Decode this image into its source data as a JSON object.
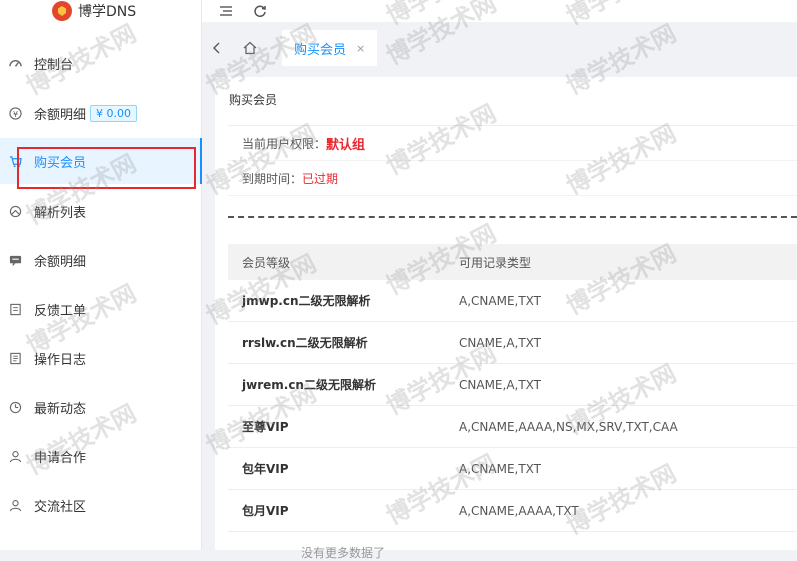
{
  "brand": {
    "name": "博学DNS"
  },
  "sidebar": {
    "items": [
      {
        "label": "控制台",
        "icon": "dashboard-icon"
      },
      {
        "label": "余额明细",
        "icon": "yen-icon",
        "badge": "¥ 0.00"
      },
      {
        "label": "购买会员",
        "icon": "cart-icon"
      },
      {
        "label": "解析列表",
        "icon": "dns-icon"
      },
      {
        "label": "余额明细",
        "icon": "message-icon"
      },
      {
        "label": "反馈工单",
        "icon": "ticket-icon"
      },
      {
        "label": "操作日志",
        "icon": "log-icon"
      },
      {
        "label": "最新动态",
        "icon": "news-icon"
      },
      {
        "label": "申请合作",
        "icon": "user-icon"
      },
      {
        "label": "交流社区",
        "icon": "community-icon"
      }
    ]
  },
  "tabs": {
    "active_label": "购买会员",
    "close_glyph": "×"
  },
  "panel": {
    "title": "购买会员",
    "permission_label": "当前用户权限：",
    "permission_value": "默认组",
    "expiry_label": "到期时间：",
    "expiry_value": "已过期"
  },
  "table": {
    "headers": [
      "会员等级",
      "可用记录类型"
    ],
    "rows": [
      {
        "level": "jmwp.cn二级无限解析",
        "types": "A,CNAME,TXT"
      },
      {
        "level": "rrslw.cn二级无限解析",
        "types": "CNAME,A,TXT"
      },
      {
        "level": "jwrem.cn二级无限解析",
        "types": "CNAME,A,TXT"
      },
      {
        "level": "至尊VIP",
        "types": "A,CNAME,AAAA,NS,MX,SRV,TXT,CAA"
      },
      {
        "level": "包年VIP",
        "types": "A,CNAME,TXT"
      },
      {
        "level": "包月VIP",
        "types": "A,CNAME,AAAA,TXT"
      }
    ],
    "empty_text": "没有更多数据了"
  },
  "watermark": "博学技术网",
  "colors": {
    "accent": "#1890ff",
    "danger": "#e8282f"
  }
}
